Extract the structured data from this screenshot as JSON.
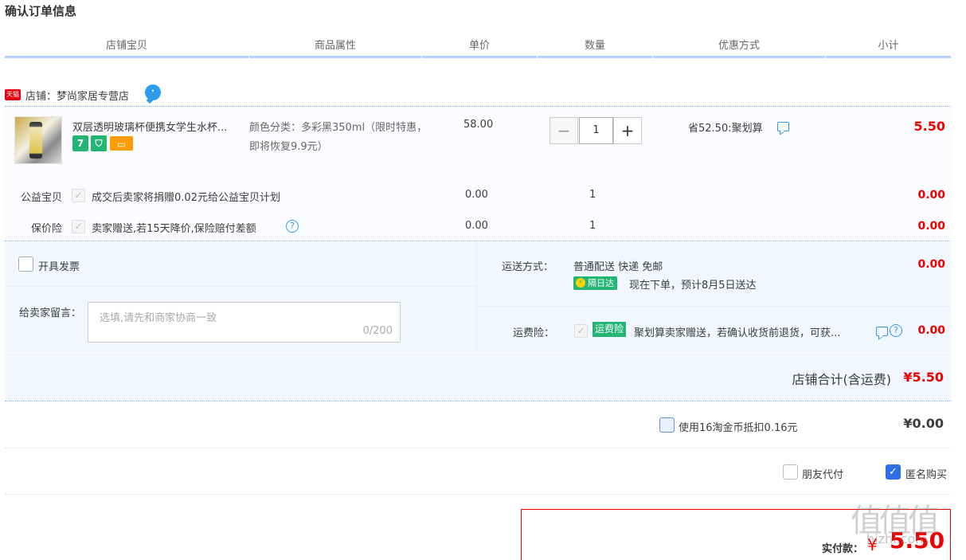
{
  "page": {
    "title": "确认订单信息"
  },
  "headers": [
    "店铺宝贝",
    "商品属性",
    "单价",
    "数量",
    "优惠方式",
    "小计"
  ],
  "shop": {
    "badge": "天猫",
    "label": "店铺：梦尚家居专营店"
  },
  "item": {
    "title": "双层透明玻璃杯便携女学生水杯...",
    "attr": "颜色分类：多彩黑350ml（限时特惠，即将恢复9.9元）",
    "price": "58.00",
    "quantity": "1",
    "promo": "省52.50:聚划算",
    "subtotal": "5.50",
    "service_icons": [
      "7",
      "shield-icon",
      "card-icon"
    ]
  },
  "extras": [
    {
      "label": "公益宝贝",
      "text": "成交后卖家将捐赠0.02元给公益宝贝计划",
      "price": "0.00",
      "qty": "1",
      "subtotal": "0.00"
    },
    {
      "label": "保价险",
      "text": "卖家赠送,若15天降价,保险赔付差额",
      "price": "0.00",
      "qty": "1",
      "subtotal": "0.00"
    }
  ],
  "options": {
    "invoice_label": "开具发票",
    "message_label": "给卖家留言：",
    "message_placeholder": "选填,请先和商家协商一致",
    "message_count": "0/200",
    "shipping_label": "运送方式：",
    "shipping_value": "普通配送 快递 免邮",
    "shipping_badge": "隔日达",
    "shipping_eta": "现在下单，预计8月5日送达",
    "shipping_fee": "0.00",
    "insurance_label": "运费险：",
    "insurance_badge": "运费险",
    "insurance_text": "聚划算卖家赠送，若确认收货前退货，可获...",
    "insurance_fee": "0.00"
  },
  "shop_total": {
    "label": "店铺合计(含运费)",
    "value": "¥5.50"
  },
  "coins": {
    "label": "使用16淘金币抵扣0.16元",
    "value": "¥0.00"
  },
  "payment": {
    "friend_label": "朋友代付",
    "anon_label": "匿名购买"
  },
  "final": {
    "label": "实付款：",
    "yen": "¥",
    "value": "5.50"
  },
  "watermark": {
    "url": "hizhi.com"
  }
}
